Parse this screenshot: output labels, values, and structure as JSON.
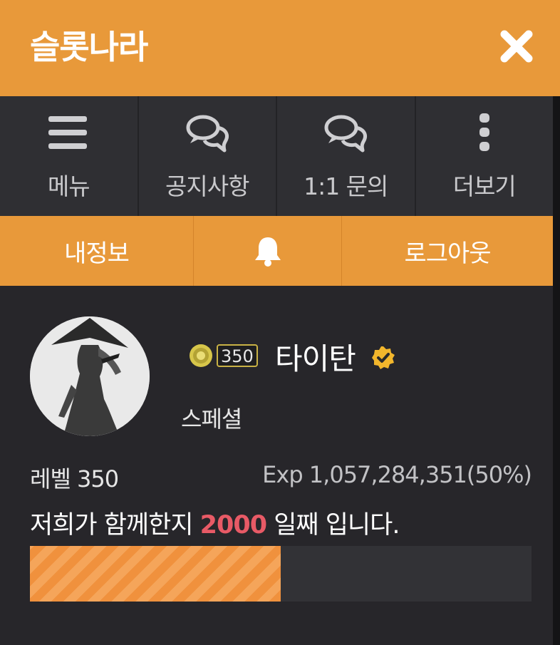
{
  "header": {
    "title": "슬롯나라"
  },
  "nav": [
    {
      "label": "메뉴",
      "icon": "hamburger-menu-icon"
    },
    {
      "label": "공지사항",
      "icon": "chat-bubbles-icon"
    },
    {
      "label": "1:1 문의",
      "icon": "chat-bubbles-icon"
    },
    {
      "label": "더보기",
      "icon": "vertical-dots-icon"
    }
  ],
  "actions": {
    "my_info": "내정보",
    "notifications_icon": "bell-icon",
    "logout": "로그아웃"
  },
  "profile": {
    "level_badge": "350",
    "nickname": "타이탄",
    "grade": "스페셜",
    "level_text": "레벨 350",
    "exp_text": "Exp 1,057,284,351(50%)",
    "together_prefix": "저희가 함께한지 ",
    "together_days": "2000",
    "together_suffix": " 일째 입니다.",
    "exp_progress": 0.5
  },
  "colors": {
    "accent": "#e8993a",
    "background": "#27262a",
    "nav_background": "#2f2f33",
    "highlight_days": "#e85a66",
    "progress_fill": "#f0913d",
    "verified_badge": "#f2b62c"
  }
}
